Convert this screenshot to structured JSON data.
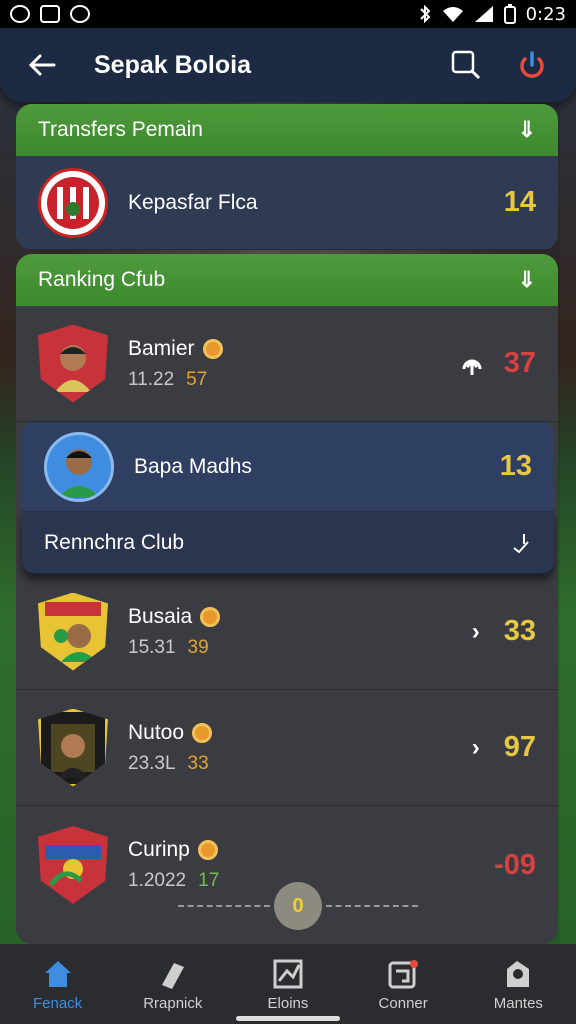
{
  "status_bar": {
    "time": "0:23"
  },
  "app_bar": {
    "title": "Sepak Boloia"
  },
  "transfers": {
    "header": "Transfers Pemain",
    "item": {
      "name": "Kepasfar Flca",
      "score": "14"
    }
  },
  "ranking": {
    "header": "Ranking Cfub",
    "rows": [
      {
        "name": "Bamier",
        "sub_a": "11.22",
        "sub_b": "57",
        "score": "37"
      },
      {
        "name": "Bapa Madhs",
        "score": "13"
      }
    ],
    "sub_header": "Rennchra Club",
    "club_rows": [
      {
        "name": "Busaia",
        "sub_a": "15.31",
        "sub_b": "39",
        "score": "33"
      },
      {
        "name": "Nutoo",
        "sub_a": "23.3L",
        "sub_b": "33",
        "score": "97"
      },
      {
        "name": "Curinp",
        "sub_a": "1.2022",
        "sub_b": "17",
        "score": "-09"
      }
    ]
  },
  "pager": {
    "current": "0"
  },
  "bottom_nav": [
    {
      "label": "Fenack"
    },
    {
      "label": "Rrapnick"
    },
    {
      "label": "Eloins"
    },
    {
      "label": "Conner"
    },
    {
      "label": "Mantes"
    }
  ],
  "colors": {
    "accent_green": "#4f9a3b",
    "app_bar": "#1d2a44",
    "score_yellow": "#e8c843",
    "score_red": "#d94040",
    "nav_active": "#3f8de0"
  }
}
